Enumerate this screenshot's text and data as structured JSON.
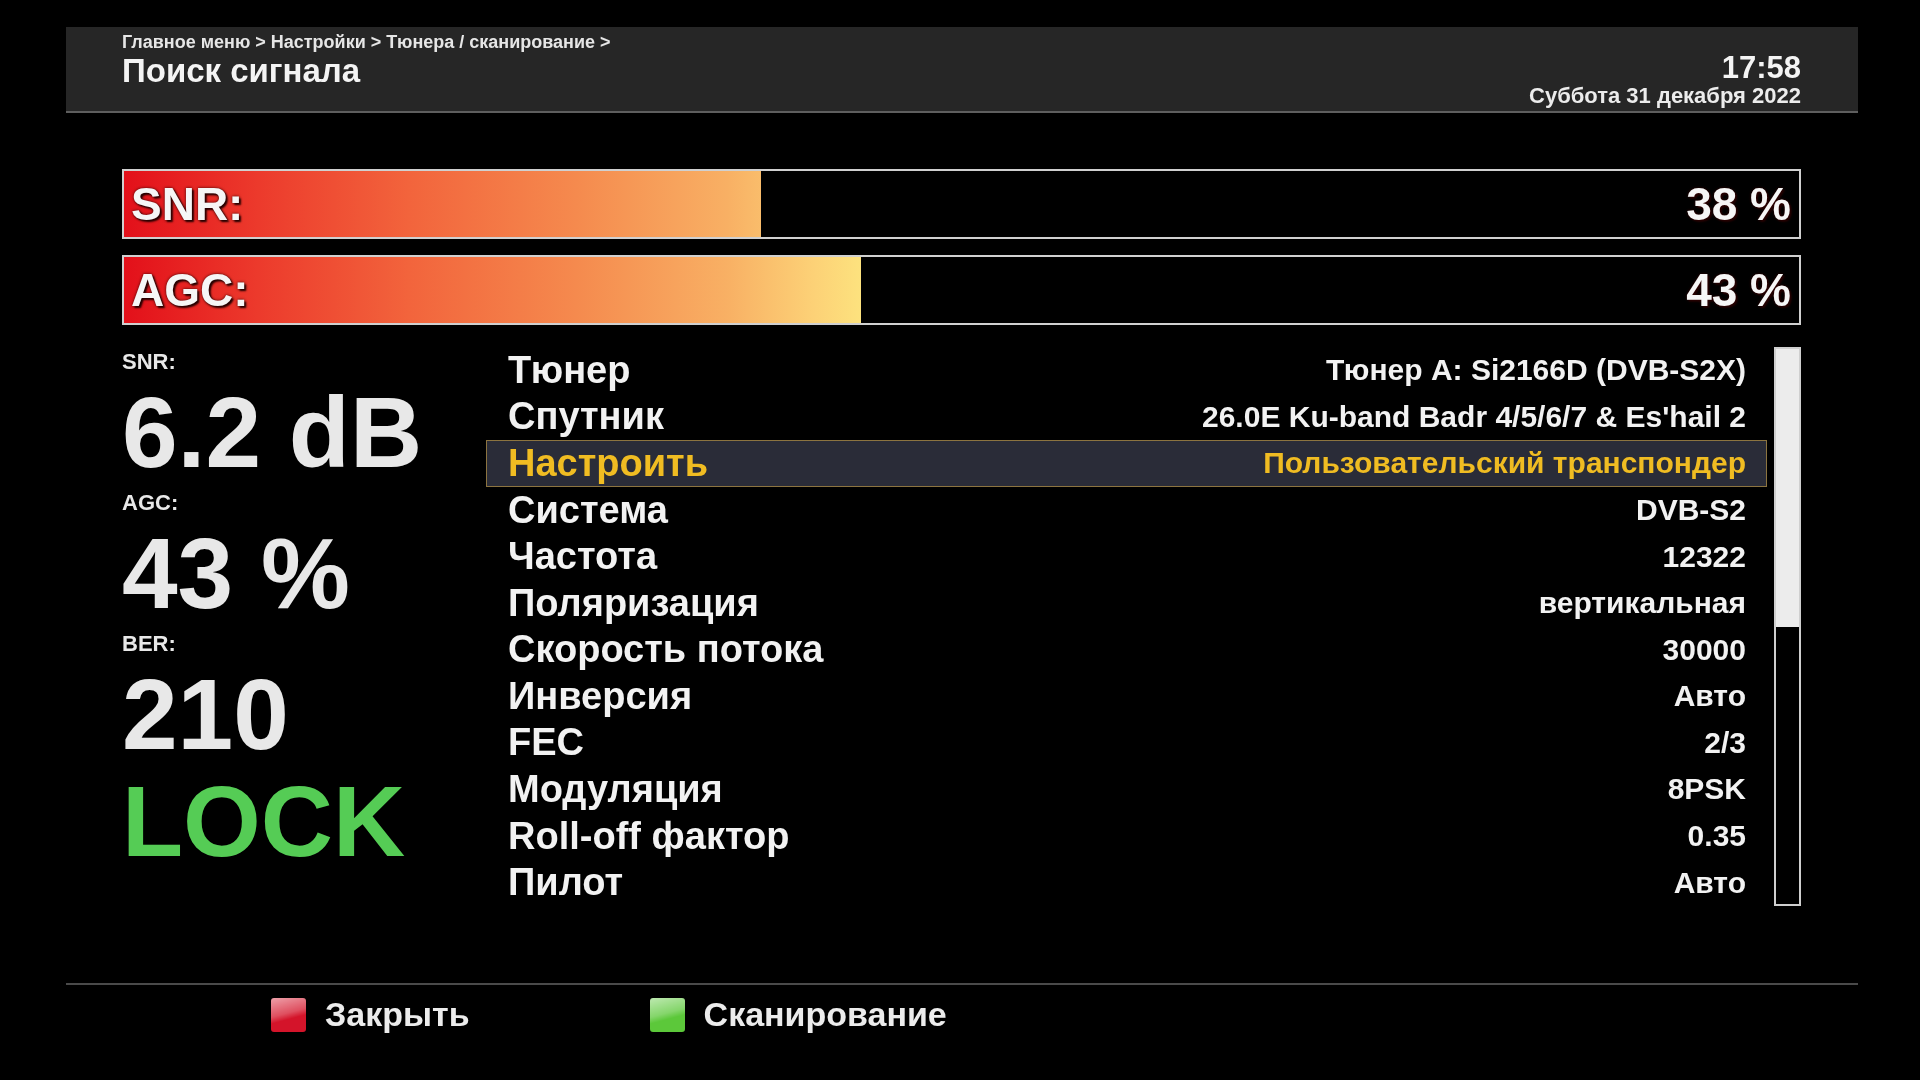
{
  "header": {
    "breadcrumb": "Главное меню > Настройки > Тюнера / сканирование >",
    "title": "Поиск сигнала",
    "time": "17:58",
    "date": "Суббота 31 декабря 2022"
  },
  "meters": [
    {
      "label": "SNR:",
      "level": 0.38,
      "reading": "38 %"
    },
    {
      "label": "AGC:",
      "level": 0.44,
      "reading": "43 %"
    }
  ],
  "readouts": [
    {
      "label": "SNR:",
      "value": "6.2 dB"
    },
    {
      "label": "AGC:",
      "value": "43 %"
    },
    {
      "label": "BER:",
      "value": "210"
    }
  ],
  "lock_status": "LOCK",
  "settings": [
    {
      "label": "Тюнер",
      "value": "Тюнер A: Si2166D (DVB-S2X)",
      "selected": false
    },
    {
      "label": "Спутник",
      "value": "26.0E Ku-band Badr 4/5/6/7 & Es'hail 2",
      "selected": false
    },
    {
      "label": "Настроить",
      "value": "Пользовательский транспондер",
      "selected": true
    },
    {
      "label": "Система",
      "value": "DVB-S2",
      "selected": false
    },
    {
      "label": "Частота",
      "value": "12322",
      "selected": false
    },
    {
      "label": "Поляризация",
      "value": "вертикальная",
      "selected": false
    },
    {
      "label": "Скорость потока",
      "value": "30000",
      "selected": false
    },
    {
      "label": "Инверсия",
      "value": "Авто",
      "selected": false
    },
    {
      "label": "FEC",
      "value": "2/3",
      "selected": false
    },
    {
      "label": "Модуляция",
      "value": "8PSK",
      "selected": false
    },
    {
      "label": "Roll-off фактор",
      "value": "0.35",
      "selected": false
    },
    {
      "label": "Пилот",
      "value": "Авто",
      "selected": false
    }
  ],
  "footer_buttons": [
    {
      "label": "Закрыть",
      "color": "#d4142a"
    },
    {
      "label": "Сканирование",
      "color": "#5cc83a"
    }
  ]
}
